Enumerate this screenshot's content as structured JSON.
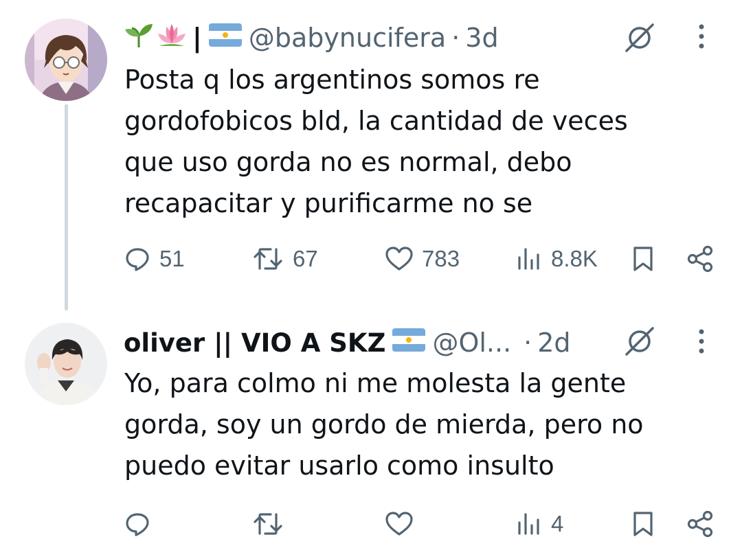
{
  "tweets": [
    {
      "name_emojis": [
        "seedling",
        "lotus"
      ],
      "name_separator": "|",
      "flag": "argentina-flag",
      "handle": "@babynucifera",
      "separator": "·",
      "time": "3d",
      "text": "Posta q los argentinos somos re\ngordofobicos bld, la cantidad de veces\nque uso gorda no es normal, debo\nrecapacitar y purificarme no se",
      "replies": "51",
      "retweets": "67",
      "likes": "783",
      "views": "8.8K"
    },
    {
      "display_name": "oliver || VIO A SKZ",
      "flag": "argentina-flag",
      "handle": "@Ol...",
      "separator": "·",
      "time": "2d",
      "text": "Yo, para colmo ni me molesta la gente\ngorda, soy un gordo de mierda, pero no\npuedo evitar usarlo como insulto",
      "replies": "",
      "retweets": "",
      "likes": "",
      "views": "4"
    }
  ],
  "colors": {
    "text_primary": "#0f1419",
    "text_secondary": "#536471",
    "thread_line": "#cfd9de"
  },
  "icons": {
    "reply": "reply-icon",
    "retweet": "retweet-icon",
    "like": "heart-icon",
    "views": "views-chart-icon",
    "bookmark": "bookmark-icon",
    "share": "share-icon",
    "grok": "grok-icon",
    "more": "more-vertical-icon"
  }
}
